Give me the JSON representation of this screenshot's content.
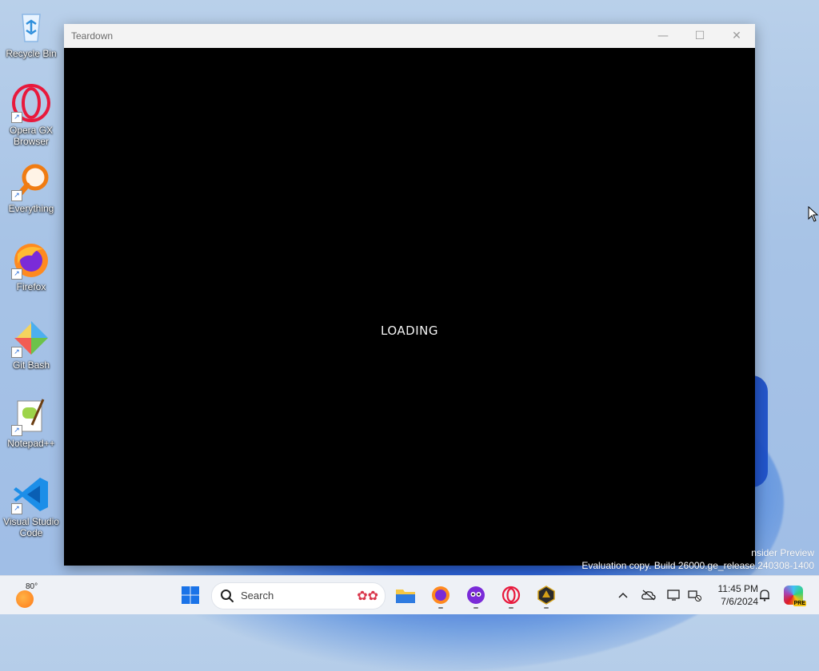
{
  "desktop": {
    "icons": [
      {
        "label": "Recycle Bin",
        "icon": "recycle-bin-icon"
      },
      {
        "label": "Opera GX Browser",
        "icon": "opera-gx-icon"
      },
      {
        "label": "Everything",
        "icon": "everything-search-icon"
      },
      {
        "label": "Firefox",
        "icon": "firefox-icon"
      },
      {
        "label": "Git Bash",
        "icon": "git-bash-icon"
      },
      {
        "label": "Notepad++",
        "icon": "notepad-plus-plus-icon"
      },
      {
        "label": "Visual Studio Code",
        "icon": "vscode-icon"
      }
    ],
    "watermark": {
      "line1": "nsider Preview",
      "line2": "Evaluation copy. Build 26000.ge_release.240308-1400"
    }
  },
  "window": {
    "title": "Teardown",
    "minimize": "—",
    "maximize": "☐",
    "close": "✕",
    "content_text": "LOADING"
  },
  "taskbar": {
    "weather_temp": "80°",
    "search_placeholder": "Search",
    "apps": [
      "start-icon",
      "file-explorer-icon",
      "firefox-icon",
      "discord-like-icon",
      "opera-gx-icon",
      "teardown-icon"
    ],
    "clock_time": "11:45 PM",
    "clock_date": "7/6/2024",
    "tray_chevron": "^"
  }
}
